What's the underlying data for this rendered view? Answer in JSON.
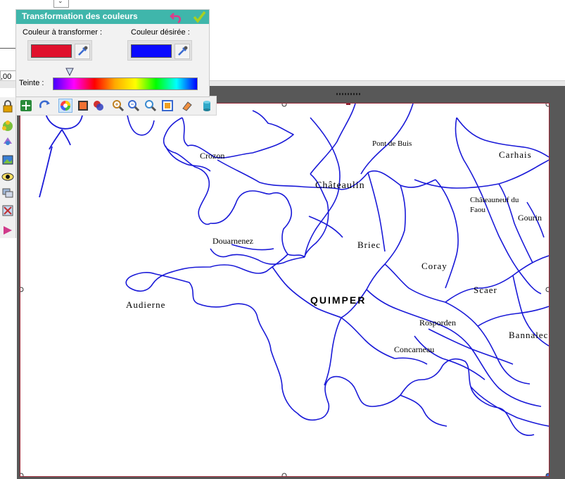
{
  "top": {
    "zoom_value": ",00"
  },
  "panel": {
    "title": "Transformation des couleurs",
    "source_label": "Couleur à transformer :",
    "target_label": "Couleur désirée :",
    "hue_label": "Teinte :",
    "source_color": "#e0102c",
    "target_color": "#0a0aff",
    "hue_position_percent": 0,
    "icons": [
      "undo-arrow-icon",
      "check-icon",
      "eyedropper-icon"
    ]
  },
  "toolbar": {
    "icons": [
      "move-icon",
      "refresh-icon",
      "color-wheel-icon",
      "image-icon",
      "color-circles-icon",
      "zoom-in-icon",
      "zoom-out-icon",
      "zoom-fit-icon",
      "fullscreen-icon",
      "eraser-icon",
      "cylinder-icon"
    ],
    "active_icon": "color-wheel-icon"
  },
  "left_toolbar": {
    "icons": [
      "lock-icon",
      "puzzle-icon",
      "recycle-icon",
      "picture-icon",
      "eye-icon",
      "layers-icon",
      "tools-icon",
      "flag-icon"
    ]
  },
  "map": {
    "line_color": "#1a1ad8",
    "places": [
      {
        "name": "Crozon"
      },
      {
        "name": "Pont de Buis"
      },
      {
        "name": "Carhais"
      },
      {
        "name": "Châteaulin"
      },
      {
        "name": "Châteauneuf du"
      },
      {
        "name": "Faou"
      },
      {
        "name": "Gourin"
      },
      {
        "name": "Douarnenez"
      },
      {
        "name": "Briec"
      },
      {
        "name": "Coray"
      },
      {
        "name": "Audierne"
      },
      {
        "name": "QUIMPER"
      },
      {
        "name": "Scaer"
      },
      {
        "name": "Rosporden"
      },
      {
        "name": "Bannalec"
      },
      {
        "name": "Concarneau"
      }
    ]
  }
}
